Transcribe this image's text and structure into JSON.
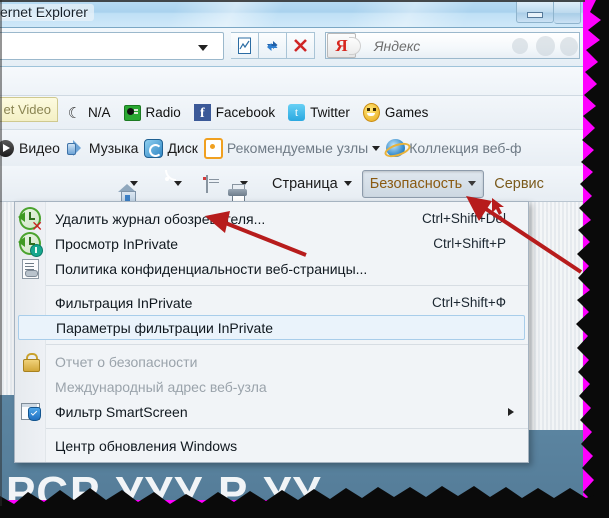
{
  "window": {
    "title": "ernet Explorer",
    "minimize_label": "Minimize"
  },
  "address_bar": {
    "url_value": "",
    "dropdown_icon": "chevron-down-icon",
    "buttons": [
      {
        "name": "compatibility-view-icon",
        "glyph": "page-broken"
      },
      {
        "name": "refresh-icon",
        "glyph": "refresh"
      },
      {
        "name": "stop-icon",
        "glyph": "x"
      }
    ]
  },
  "search": {
    "provider_letter": "Я",
    "placeholder": "Яндекс"
  },
  "links_bar": {
    "tab_label": "et Video",
    "items": [
      {
        "icon": "moon-icon",
        "label": "N/A"
      },
      {
        "icon": "radio-icon",
        "label": "Radio"
      },
      {
        "icon": "facebook-icon",
        "label": "Facebook"
      },
      {
        "icon": "twitter-icon",
        "label": "Twitter"
      },
      {
        "icon": "games-smiley-icon",
        "label": "Games"
      }
    ]
  },
  "command_bar": {
    "items": [
      {
        "icon": "video-icon",
        "label": "Видео",
        "caret": false
      },
      {
        "icon": "music-speaker-icon",
        "label": "Музыка",
        "caret": false
      },
      {
        "icon": "disk-icon",
        "label": "Диск",
        "caret": false
      },
      {
        "icon": "rss-suggested-icon",
        "label": "Рекомендуемые узлы",
        "caret": true
      },
      {
        "icon": "ie-logo-icon",
        "label": "Коллекция веб-ф",
        "caret": false
      }
    ]
  },
  "command_bar2": {
    "home_icon": "home-icon",
    "feeds_icon": "rss-icon",
    "mail_icon": "mail-icon",
    "print_icon": "printer-icon",
    "page_label": "Страница",
    "security_label": "Безопасность",
    "tools_label": "Сервис"
  },
  "menu": {
    "groups": [
      {
        "items": [
          {
            "icon": "delete-history-icon",
            "label": "Удалить журнал обозревателя...",
            "accel": "Ctrl+Shift+Del",
            "state": "normal"
          },
          {
            "icon": "inprivate-browsing-icon",
            "label": "Просмотр InPrivate",
            "accel": "Ctrl+Shift+P",
            "state": "normal"
          },
          {
            "icon": "privacy-policy-icon",
            "label": "Политика конфиденциальности веб-страницы...",
            "accel": "",
            "state": "normal"
          }
        ]
      },
      {
        "items": [
          {
            "icon": "",
            "label": "Фильтрация InPrivate",
            "accel": "Ctrl+Shift+Ф",
            "state": "normal"
          },
          {
            "icon": "",
            "label": "Параметры фильтрации InPrivate",
            "accel": "",
            "state": "selected"
          }
        ]
      },
      {
        "items": [
          {
            "icon": "lock-icon",
            "label": "Отчет о безопасности",
            "accel": "",
            "state": "disabled"
          },
          {
            "icon": "",
            "label": "Международный адрес веб-узла",
            "accel": "",
            "state": "disabled"
          },
          {
            "icon": "smartscreen-icon",
            "label": "Фильтр SmartScreen",
            "accel": "",
            "state": "submenu"
          }
        ]
      },
      {
        "items": [
          {
            "icon": "",
            "label": "Центр обновления Windows",
            "accel": "",
            "state": "normal"
          }
        ]
      }
    ]
  },
  "wallpaper": {
    "bottom_text": "РСР УУУ  Р  УУ"
  },
  "annotations": {
    "arrow1_name": "red-arrow-to-delete-history",
    "arrow2_name": "red-arrow-to-security-button"
  },
  "colors": {
    "frame_magenta": "#ff00ff",
    "accent_orange": "#8a5a12",
    "selection_blue": "#a8cdea"
  }
}
